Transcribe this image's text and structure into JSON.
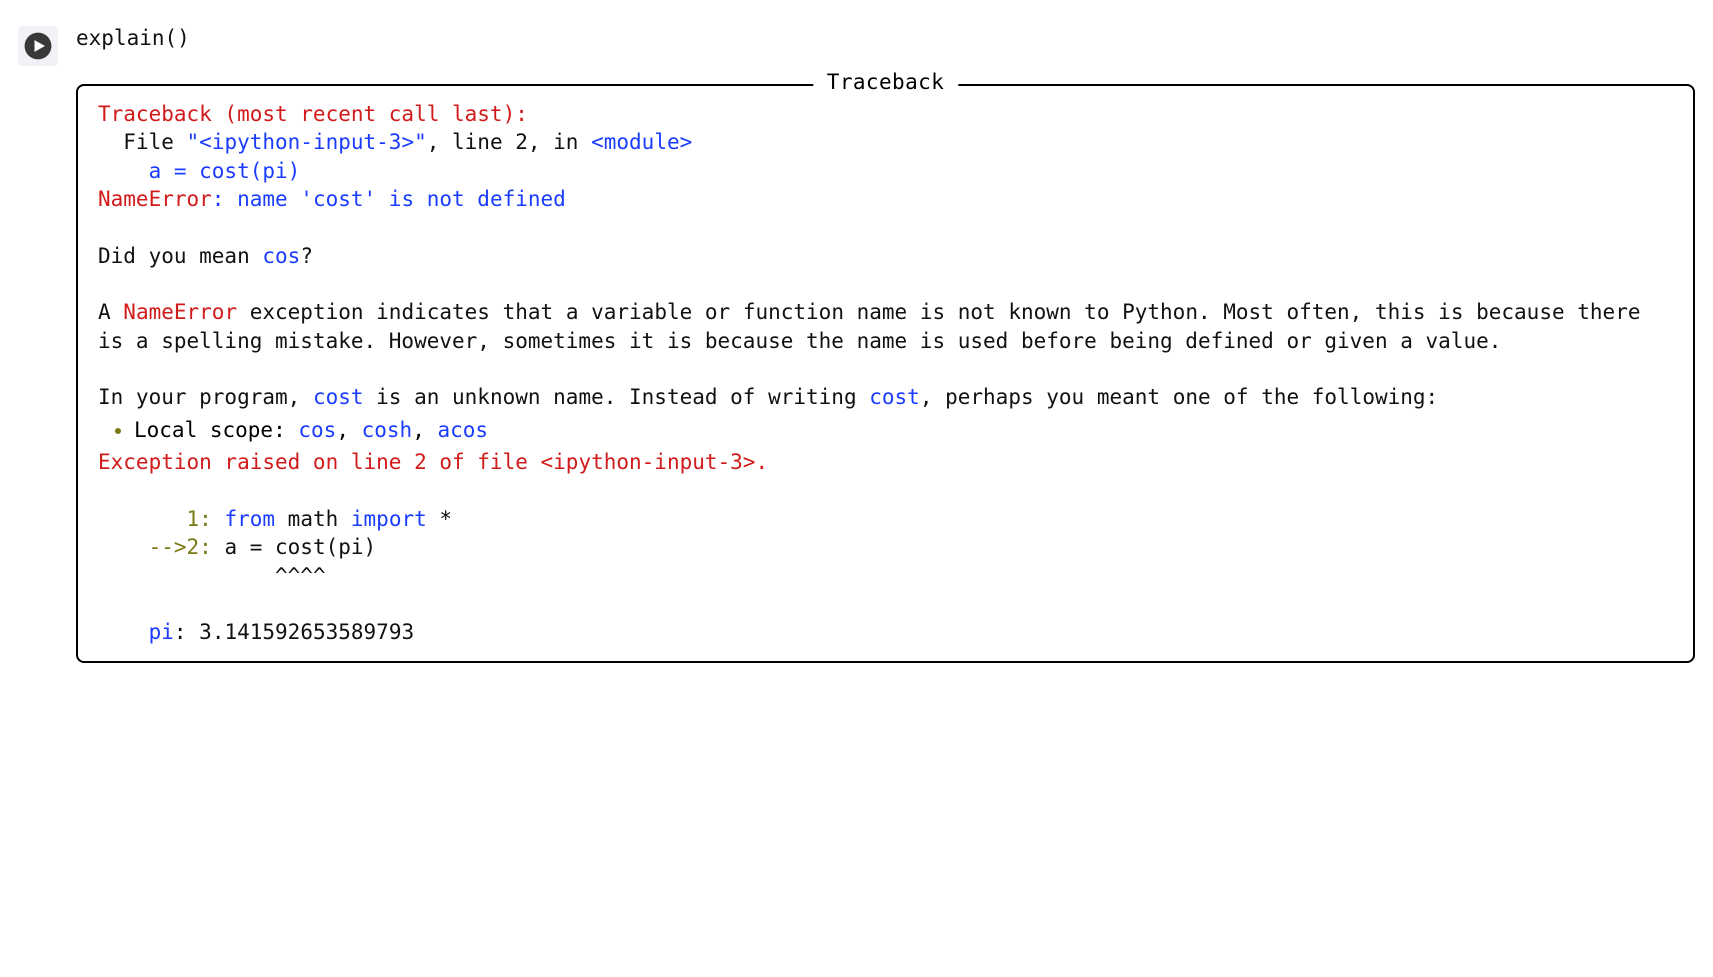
{
  "cell": {
    "code": "explain()"
  },
  "output": {
    "legend": " Traceback ",
    "tb_header": "Traceback (most recent call last):",
    "tb_file_prefix": "  File ",
    "tb_file_name": "\"<ipython-input-3>\"",
    "tb_file_linepart": ", line 2, in ",
    "tb_file_module": "<module>",
    "tb_code": "    a = cost(pi)",
    "name_error": "NameError",
    "name_error_msg": ": name 'cost' is not defined",
    "dym_prefix": "Did you mean ",
    "dym_suggestion": "cos",
    "dym_suffix": "?",
    "expl_p1a": "A ",
    "expl_p1b": "NameError",
    "expl_p1c": " exception indicates that a variable or function name is not known to Python. Most often, this is because there is a spelling mistake. However, sometimes it is because the name is used before being defined or given a value.",
    "expl_p2a": "In your program, ",
    "expl_p2b": "cost",
    "expl_p2c": " is an unknown name. Instead of writing ",
    "expl_p2d": "cost",
    "expl_p2e": ", perhaps you meant one of the following:",
    "scope_label": "Local scope: ",
    "scope_s1": "cos",
    "scope_s2": "cosh",
    "scope_s3": "acos",
    "raised_a": "Exception raised on line 2 of file ",
    "raised_b": "<ipython-input-3>",
    "raised_c": ".",
    "ctx_line1_num": "       1: ",
    "ctx_line1_a": "from",
    "ctx_line1_b": " math ",
    "ctx_line1_c": "import",
    "ctx_line1_d": " *",
    "ctx_line2_num": "    -->2: ",
    "ctx_line2_code": "a = cost(pi)",
    "ctx_caret": "              ^^^^",
    "var_name": "    pi",
    "var_sep": ": ",
    "var_val": "3.141592653589793"
  }
}
